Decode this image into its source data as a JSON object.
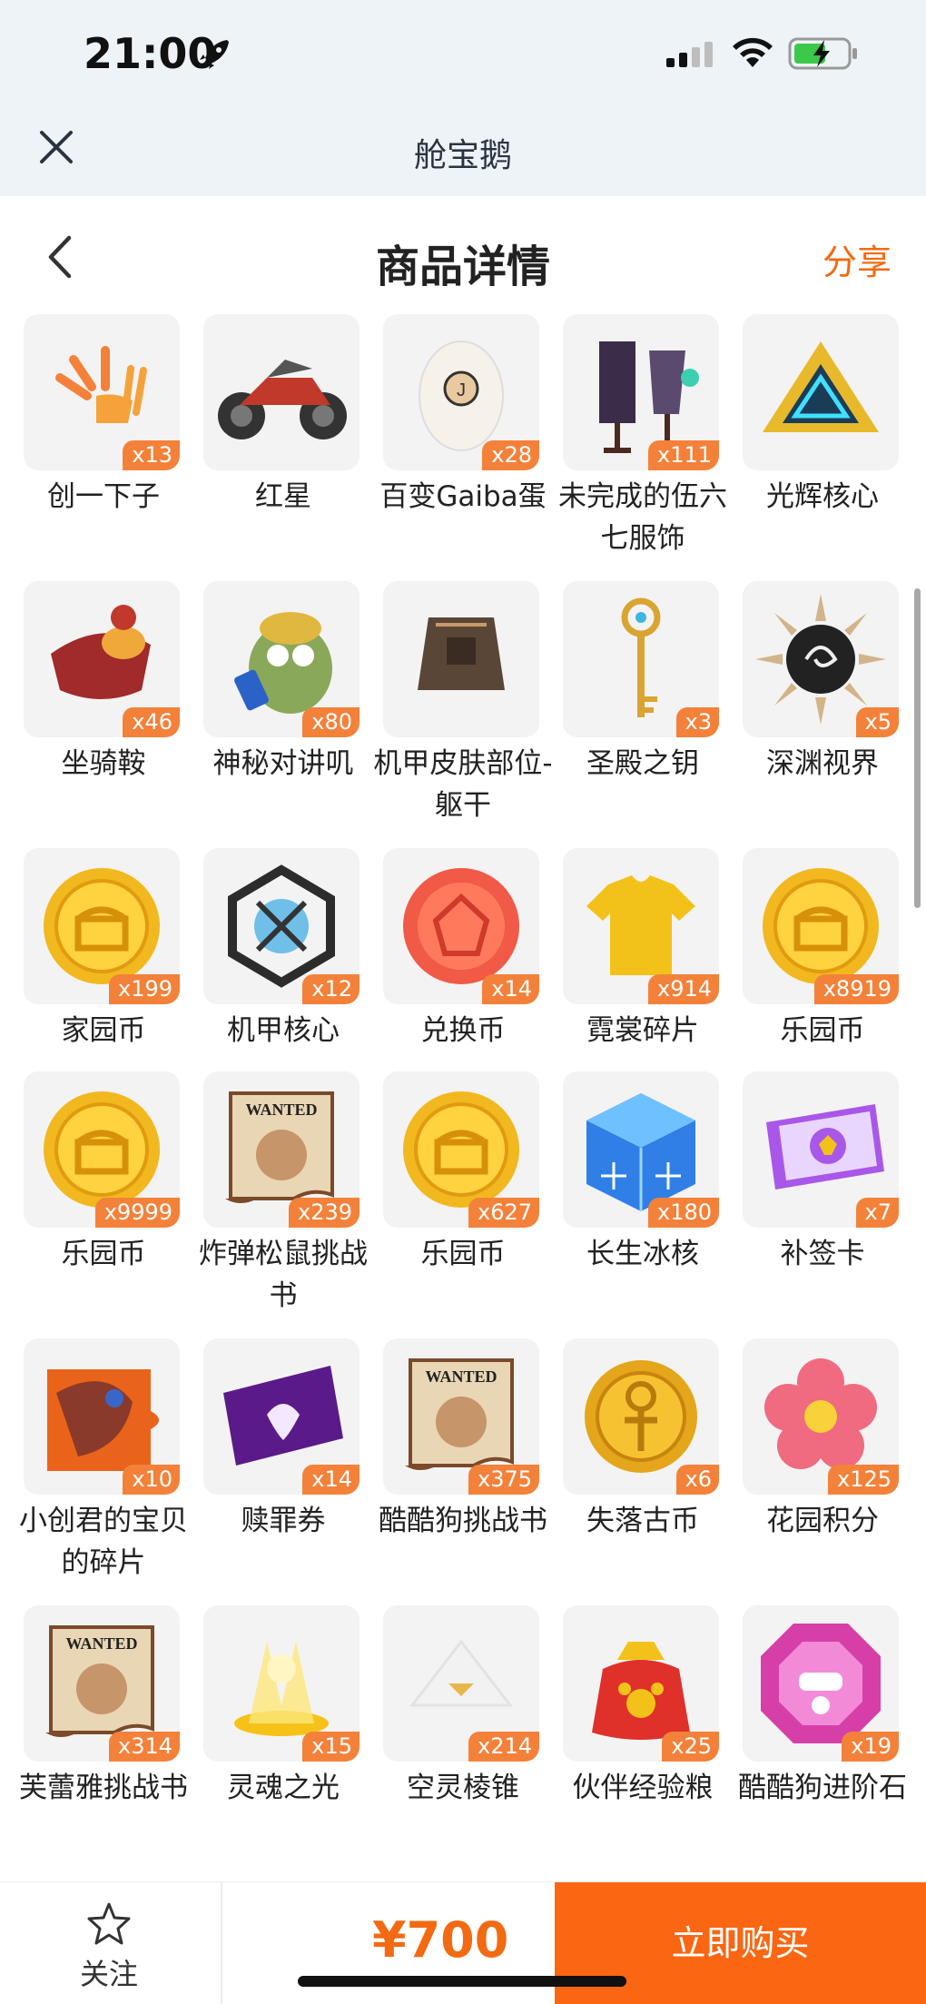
{
  "status_bar": {
    "time": "21:00"
  },
  "topbar": {
    "title": "舱宝鹅"
  },
  "header": {
    "title": "商品详情",
    "share_label": "分享"
  },
  "colors": {
    "accent": "#f26a12",
    "badge": "#f4813a",
    "buy": "#fa6611"
  },
  "items": [
    {
      "name": "创一下子",
      "count": "x13",
      "icon": "slash-burst-icon"
    },
    {
      "name": "红星",
      "count": "",
      "icon": "motorcycle-icon"
    },
    {
      "name": "百变Gaiba蛋",
      "count": "x28",
      "icon": "egg-icon"
    },
    {
      "name": "未完成的伍六七服饰",
      "count": "x111",
      "icon": "costume-stand-icon"
    },
    {
      "name": "光辉核心",
      "count": "",
      "icon": "triangle-core-icon"
    },
    {
      "name": "坐骑鞍",
      "count": "x46",
      "icon": "saddle-icon"
    },
    {
      "name": "神秘对讲叽",
      "count": "x80",
      "icon": "bird-walkie-icon"
    },
    {
      "name": "机甲皮肤部位-躯干",
      "count": "",
      "icon": "mech-torso-icon"
    },
    {
      "name": "圣殿之钥",
      "count": "x3",
      "icon": "key-icon"
    },
    {
      "name": "深渊视界",
      "count": "x5",
      "icon": "abyss-sun-icon"
    },
    {
      "name": "家园币",
      "count": "x199",
      "icon": "gold-coin-icon"
    },
    {
      "name": "机甲核心",
      "count": "x12",
      "icon": "mech-core-icon"
    },
    {
      "name": "兑换币",
      "count": "x14",
      "icon": "red-coin-icon"
    },
    {
      "name": "霓裳碎片",
      "count": "x914",
      "icon": "shirt-icon"
    },
    {
      "name": "乐园币",
      "count": "x8919",
      "icon": "gold-coin-icon"
    },
    {
      "name": "乐园币",
      "count": "x9999",
      "icon": "gold-coin-icon"
    },
    {
      "name": "炸弹松鼠挑战书",
      "count": "x239",
      "icon": "wanted-scroll-icon"
    },
    {
      "name": "乐园币",
      "count": "x627",
      "icon": "gold-coin-icon"
    },
    {
      "name": "长生冰核",
      "count": "x180",
      "icon": "ice-cube-icon"
    },
    {
      "name": "补签卡",
      "count": "x7",
      "icon": "ticket-icon"
    },
    {
      "name": "小创君的宝贝的碎片",
      "count": "x10",
      "icon": "puzzle-piece-icon"
    },
    {
      "name": "赎罪券",
      "count": "x14",
      "icon": "purple-card-icon"
    },
    {
      "name": "酷酷狗挑战书",
      "count": "x375",
      "icon": "wanted-scroll-icon"
    },
    {
      "name": "失落古币",
      "count": "x6",
      "icon": "ankh-coin-icon"
    },
    {
      "name": "花园积分",
      "count": "x125",
      "icon": "flower-icon"
    },
    {
      "name": "芙蕾雅挑战书",
      "count": "x314",
      "icon": "wanted-scroll-icon"
    },
    {
      "name": "灵魂之光",
      "count": "x15",
      "icon": "soul-light-icon"
    },
    {
      "name": "空灵棱锥",
      "count": "x214",
      "icon": "pyramid-icon"
    },
    {
      "name": "伙伴经验粮",
      "count": "x25",
      "icon": "food-bag-icon"
    },
    {
      "name": "酷酷狗进阶石",
      "count": "x19",
      "icon": "gem-stone-icon"
    }
  ],
  "bottom": {
    "follow_label": "关注",
    "price": "¥700",
    "buy_label": "立即购买"
  }
}
